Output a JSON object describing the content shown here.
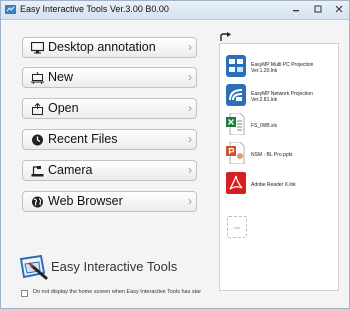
{
  "window": {
    "title": "Easy Interactive Tools Ver.3.00 B0.00",
    "min_icon": "minimize-icon",
    "max_icon": "maximize-icon",
    "close_icon": "close-icon"
  },
  "menu": [
    {
      "label": "Desktop annotation",
      "icon": "monitor-icon"
    },
    {
      "label": "New",
      "icon": "new-board-icon"
    },
    {
      "label": "Open",
      "icon": "open-folder-icon"
    },
    {
      "label": "Recent Files",
      "icon": "clock-icon"
    },
    {
      "label": "Camera",
      "icon": "document-camera-icon"
    },
    {
      "label": "Web Browser",
      "icon": "globe-icon"
    }
  ],
  "shortcuts": [
    {
      "name": "EasyMP Multi PC Projection Ver.1.20.lnk",
      "line1": "EasyMP Multi PC Projection",
      "line2": "Ver.1.20.lnk",
      "icon": "multi-pc-projection-icon"
    },
    {
      "name": "EasyMP Network Projection Ver.2.81.lnk",
      "line1": "EasyMP Network Projection",
      "line2": "Ver.2.81.lnk",
      "icon": "network-projection-icon"
    },
    {
      "name": "FS_IWB.xls",
      "line1": "FS_IWB.xls",
      "line2": "",
      "icon": "excel-file-icon"
    },
    {
      "name": "NSM - BL Pro.pptx",
      "line1": "NSM - BL Pro.pptx",
      "line2": "",
      "icon": "powerpoint-file-icon"
    },
    {
      "name": "Adobe Reader X.lnk",
      "line1": "Adobe Reader X.lnk",
      "line2": "",
      "icon": "adobe-reader-icon"
    }
  ],
  "add_slot_label": "add",
  "brand": {
    "text": "Easy Interactive Tools"
  },
  "footer": {
    "checkbox_label": "Do not display the home screen when Easy Interactive Tools has star",
    "checked": false
  },
  "colors": {
    "accent_blue": "#2a6fb8",
    "adobe_red": "#d6201f",
    "excel_green": "#1f7a3a",
    "ppt_orange": "#d2532a"
  }
}
